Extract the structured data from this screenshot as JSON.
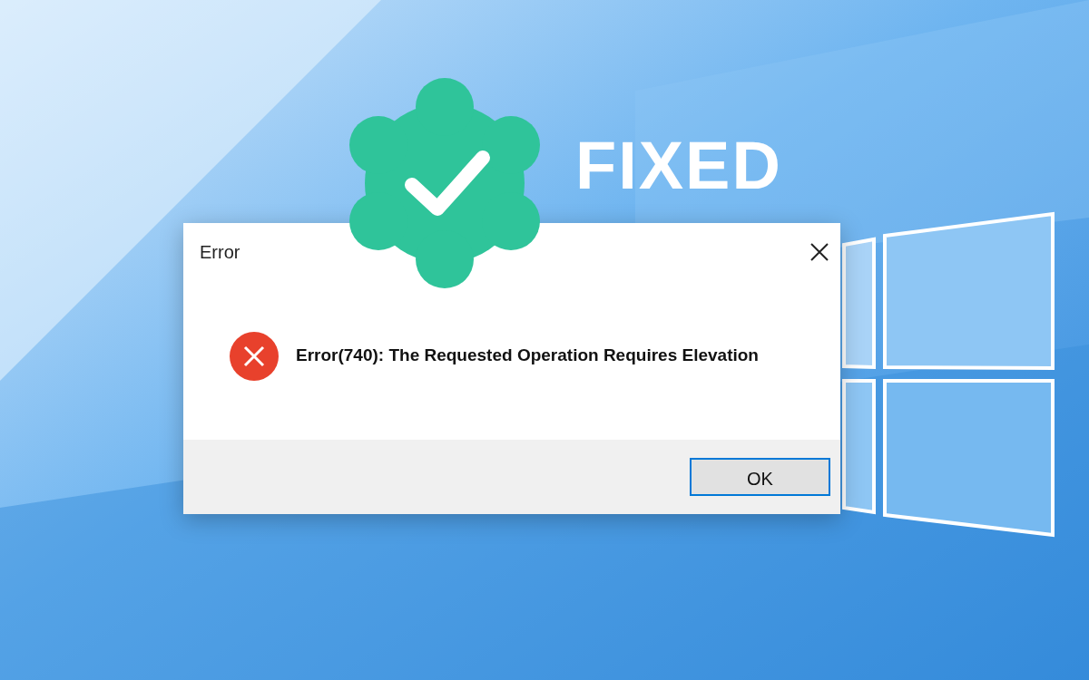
{
  "banner": {
    "badge_text": "FIXED"
  },
  "dialog": {
    "title": "Error",
    "message": "Error(740): The Requested Operation Requires Elevation",
    "buttons": [
      {
        "label": "OK",
        "selected": true
      }
    ]
  }
}
